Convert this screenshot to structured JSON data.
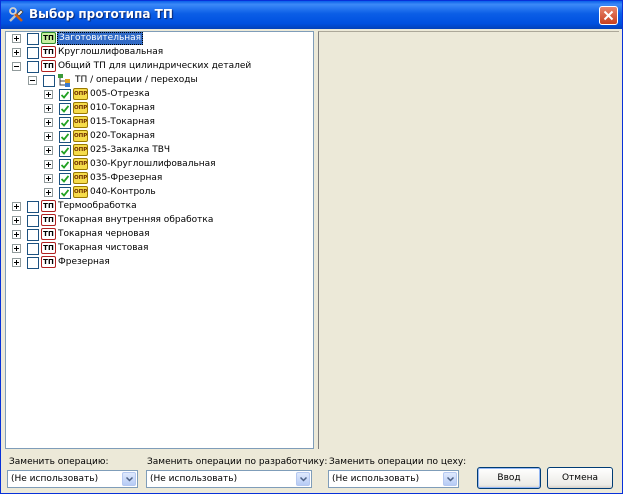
{
  "window": {
    "title": "Выбор прототипа ТП"
  },
  "badges": {
    "tp": "ТП",
    "opr": "ОПР"
  },
  "tree": {
    "root_items": [
      {
        "label": "Заготовительная",
        "selected": true
      },
      {
        "label": "Круглошлифовальная"
      },
      {
        "label": "Общий ТП для цилиндрических деталей"
      }
    ],
    "ops_group": {
      "label": "ТП / операции / переходы"
    },
    "operations": [
      "005-Отрезка",
      "010-Токарная",
      "015-Токарная",
      "020-Токарная",
      "025-Закалка ТВЧ",
      "030-Круглошлифовальная",
      "035-Фрезерная",
      "040-Контроль"
    ],
    "root_items_after": [
      "Термообработка",
      "Токарная внутренняя обработка",
      "Токарная черновая",
      "Токарная чистовая",
      "Фрезерная"
    ]
  },
  "footer": {
    "replace_operation": {
      "label": "Заменить операцию:",
      "value": "(Не использовать)"
    },
    "replace_by_developer": {
      "label": "Заменить операции по разработчику:",
      "value": "(Не использовать)"
    },
    "replace_by_workshop": {
      "label": "Заменить операции по цеху:",
      "value": "(Не использовать)"
    },
    "ok_button": "Ввод",
    "cancel_button": "Отмена"
  }
}
